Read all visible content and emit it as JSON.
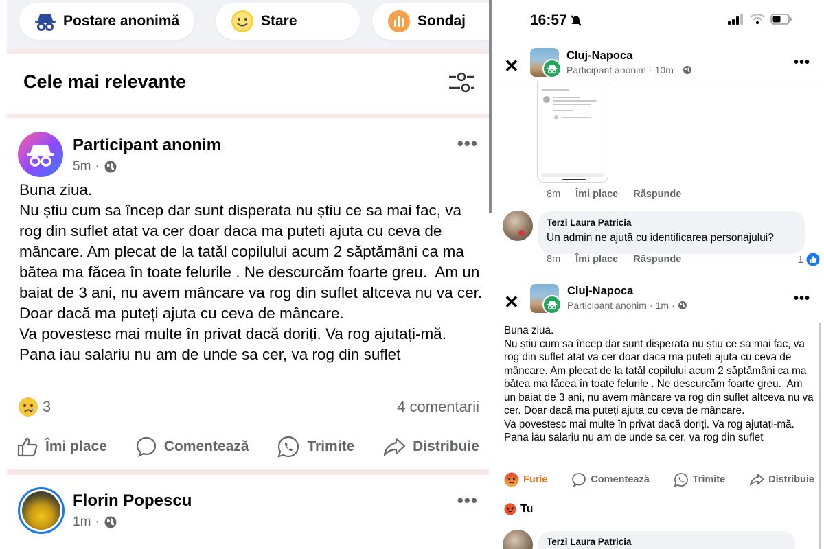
{
  "left": {
    "chips": [
      {
        "label": "Postare anonimă",
        "icon": "incognito-icon"
      },
      {
        "label": "Stare",
        "icon": "smiley-icon"
      },
      {
        "label": "Sondaj",
        "icon": "poll-icon"
      }
    ],
    "sort_title": "Cele mai relevante",
    "post": {
      "author": "Participant anonim",
      "time": "5m",
      "body": "Buna ziua.\nNu știu cum sa încep dar sunt disperata nu știu ce sa mai fac, va rog din suflet atat va cer doar daca ma puteti ajuta cu ceva de mâncare. Am plecat de la tatăl copilului acum 2 săptămâni ca ma bătea ma făcea în toate felurile . Ne descurcăm foarte greu.  Am un baiat de 3 ani, nu avem mâncare va rog din suflet altceva nu va cer. Doar dacă ma puteți ajuta cu ceva de mâncare.\nVa povestesc mai multe în privat dacă doriți. Va rog ajutați-mă. Pana iau salariu nu am de unde sa cer, va rog din suflet",
      "reaction_count": "3",
      "comments": "4 comentarii",
      "actions": [
        "Îmi place",
        "Comentează",
        "Trimite",
        "Distribuie"
      ]
    },
    "next_post": {
      "author": "Florin Popescu",
      "time": "1m"
    }
  },
  "right": {
    "status": {
      "time": "16:57"
    },
    "header1": {
      "group": "Cluj-Napoca",
      "author": "Participant anonim",
      "time": "10m"
    },
    "comment1_meta": {
      "time": "8m",
      "like": "Îmi place",
      "reply": "Răspunde"
    },
    "comment2": {
      "author": "Terzi Laura Patricia",
      "text": "Un admin ne ajută cu identificarea personajului?",
      "time": "8m",
      "like": "Îmi place",
      "reply": "Răspunde",
      "likes": "1"
    },
    "header2": {
      "group": "Cluj-Napoca",
      "author": "Participant anonim",
      "time": "1m"
    },
    "body": "Buna ziua.\nNu știu cum sa încep dar sunt disperata nu știu ce sa mai fac, va rog din suflet atat va cer doar daca ma puteti ajuta cu ceva de mâncare. Am plecat de la tatăl copilului acum 2 săptămâni ca ma bătea ma făcea în toate felurile . Ne descurcăm foarte greu.  Am un baiat de 3 ani, nu avem mâncare va rog din suflet altceva nu va cer. Doar dacă ma puteți ajuta cu ceva de mâncare.\nVa povestesc mai multe în privat dacă doriți. Va rog ajutați-mă. Pana iau salariu nu am de unde sa cer, va rog din suflet",
    "actions": [
      "Furie",
      "Comentează",
      "Trimite",
      "Distribuie"
    ],
    "reaction_by": "Tu",
    "bottom_comment_author": "Terzi Laura Patricia"
  },
  "colors": {
    "facebook_blue": "#1877f2",
    "angry_orange": "#e4781f",
    "anon_green": "#22a65a"
  }
}
